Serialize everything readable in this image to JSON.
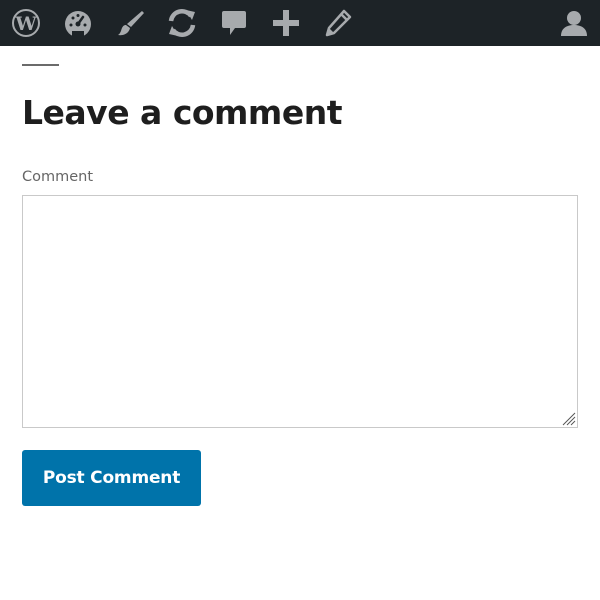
{
  "admin_bar": {
    "background": "#1d2327",
    "icon_color": "#a7aaad",
    "items": [
      {
        "icon": "wordpress-logo-icon"
      },
      {
        "icon": "dashboard-gauge-icon"
      },
      {
        "icon": "customize-brush-icon"
      },
      {
        "icon": "updates-refresh-icon"
      },
      {
        "icon": "comments-bubble-icon"
      },
      {
        "icon": "new-content-plus-icon"
      },
      {
        "icon": "edit-pencil-icon"
      }
    ],
    "account": {
      "icon": "user-avatar-icon"
    }
  },
  "comment_form": {
    "heading": "Leave a comment",
    "label": "Comment",
    "value": "",
    "submit_label": "Post Comment",
    "accent_color": "#0073aa"
  }
}
